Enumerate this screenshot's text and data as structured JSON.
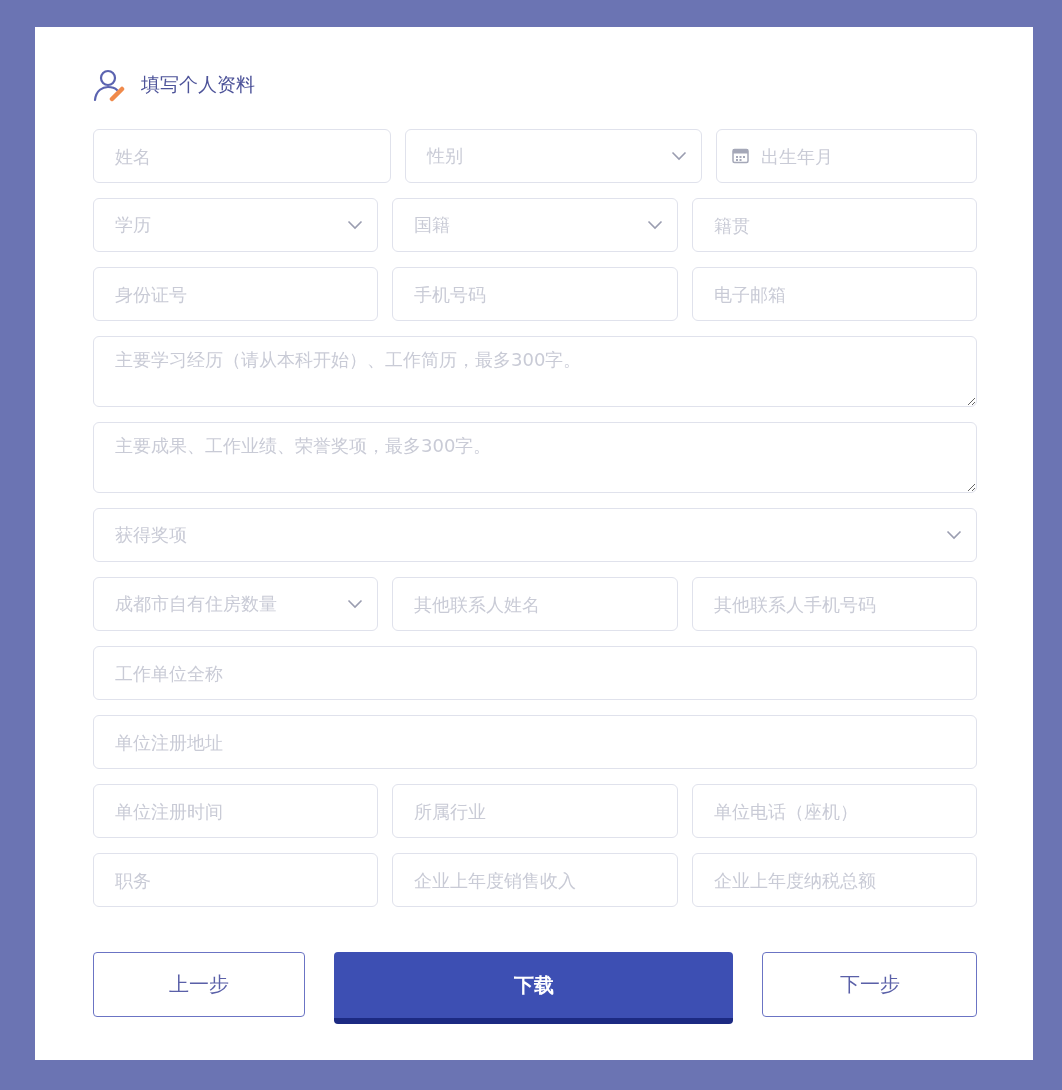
{
  "header": {
    "title": "填写个人资料"
  },
  "rows": [
    [
      {
        "kind": "text",
        "placeholder": "姓名"
      },
      {
        "kind": "select",
        "placeholder": "性别"
      },
      {
        "kind": "date",
        "placeholder": "出生年月"
      }
    ],
    [
      {
        "kind": "select",
        "placeholder": "学历"
      },
      {
        "kind": "select",
        "placeholder": "国籍"
      },
      {
        "kind": "text",
        "placeholder": "籍贯"
      }
    ],
    [
      {
        "kind": "text",
        "placeholder": "身份证号"
      },
      {
        "kind": "text",
        "placeholder": "手机号码"
      },
      {
        "kind": "text",
        "placeholder": "电子邮箱"
      }
    ],
    [
      {
        "kind": "textarea",
        "placeholder": "主要学习经历（请从本科开始）、工作简历，最多300字。"
      }
    ],
    [
      {
        "kind": "textarea",
        "placeholder": "主要成果、工作业绩、荣誉奖项，最多300字。"
      }
    ],
    [
      {
        "kind": "select",
        "placeholder": "获得奖项"
      }
    ],
    [
      {
        "kind": "select",
        "placeholder": "成都市自有住房数量"
      },
      {
        "kind": "text",
        "placeholder": "其他联系人姓名"
      },
      {
        "kind": "text",
        "placeholder": "其他联系人手机号码"
      }
    ],
    [
      {
        "kind": "text",
        "placeholder": "工作单位全称"
      }
    ],
    [
      {
        "kind": "text",
        "placeholder": "单位注册地址"
      }
    ],
    [
      {
        "kind": "text",
        "placeholder": "单位注册时间"
      },
      {
        "kind": "text",
        "placeholder": "所属行业"
      },
      {
        "kind": "text",
        "placeholder": "单位电话（座机）"
      }
    ],
    [
      {
        "kind": "text",
        "placeholder": "职务"
      },
      {
        "kind": "text",
        "placeholder": "企业上年度销售收入"
      },
      {
        "kind": "text",
        "placeholder": "企业上年度纳税总额"
      }
    ]
  ],
  "buttons": [
    {
      "kind": "outline",
      "label": "上一步"
    },
    {
      "kind": "primary",
      "label": "下载"
    },
    {
      "kind": "outline",
      "label": "下一步"
    }
  ]
}
